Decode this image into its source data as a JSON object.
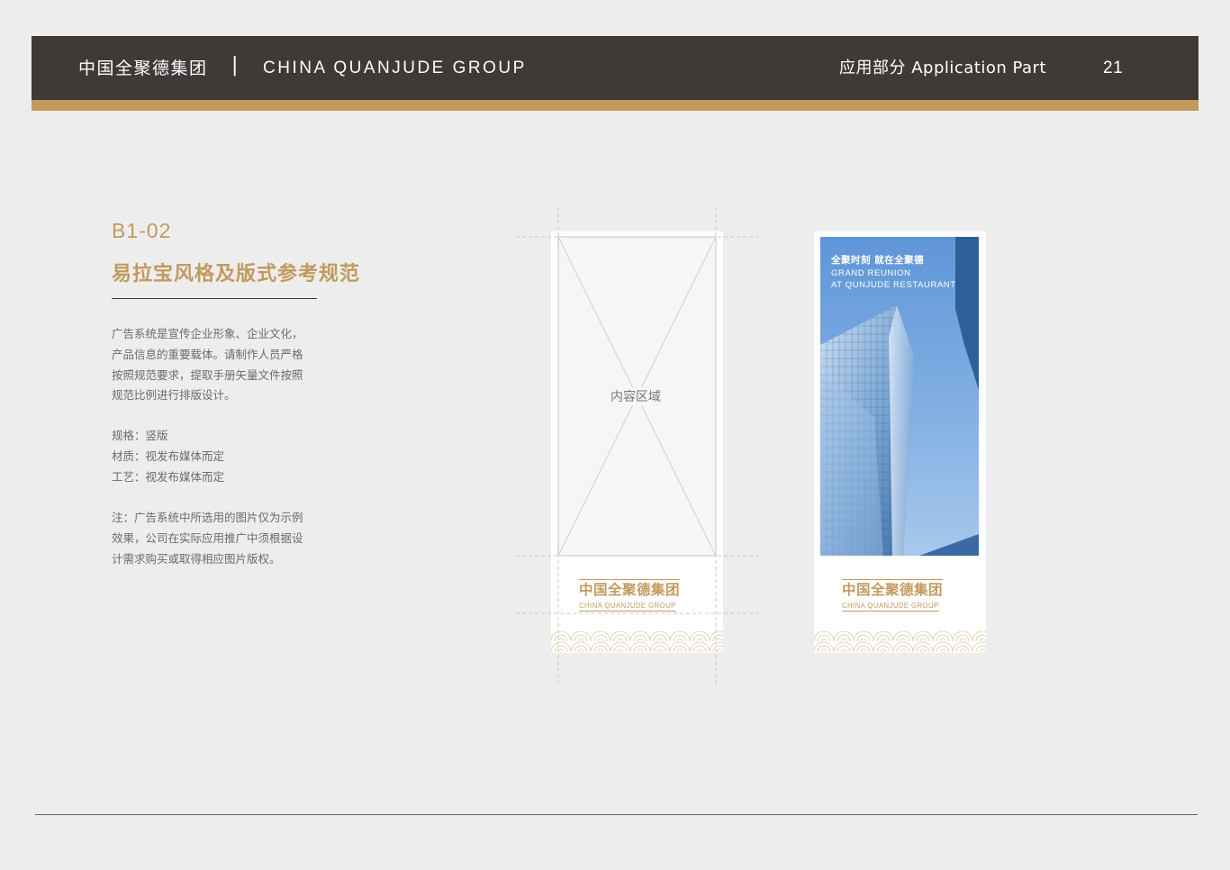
{
  "header": {
    "company_cn": "中国全聚德集团",
    "separator": "|",
    "company_en": "CHINA QUANJUDE GROUP",
    "section": "应用部分  Application Part",
    "page_number": "21"
  },
  "section": {
    "code": "B1-02",
    "title": "易拉宝风格及版式参考规范"
  },
  "description": {
    "paragraph1": [
      "广告系统是宣传企业形象、企业文化，",
      "产品信息的重要载体。请制作人员严格",
      "按照规范要求，提取手册矢量文件按照",
      "规范比例进行排版设计。"
    ],
    "specs": [
      "规格：竖版",
      "材质：视发布媒体而定",
      "工艺：视发布媒体而定"
    ],
    "note": [
      "注：广告系统中所选用的图片仅为示例",
      "效果，公司在实际应用推广中须根据设",
      "计需求购买或取得相应图片版权。"
    ]
  },
  "template_banner": {
    "content_area_label": "内容区域",
    "logo_cn": "中国全聚德集团",
    "logo_en": "CHINA QUANJUDE GROUP"
  },
  "example_banner": {
    "slogan_cn": "全聚时刻 就在全聚德",
    "slogan_en_line1": "GRAND REUNION",
    "slogan_en_line2": "AT QUNJUDE RESTAURANT",
    "logo_cn": "中国全聚德集团",
    "logo_en": "CHINA QUANJUDE GROUP"
  },
  "colors": {
    "brand_gold": "#c29a5e",
    "header_dark": "#3d3a38",
    "background": "#ededed",
    "sky_blue": "#6aa0dc"
  }
}
